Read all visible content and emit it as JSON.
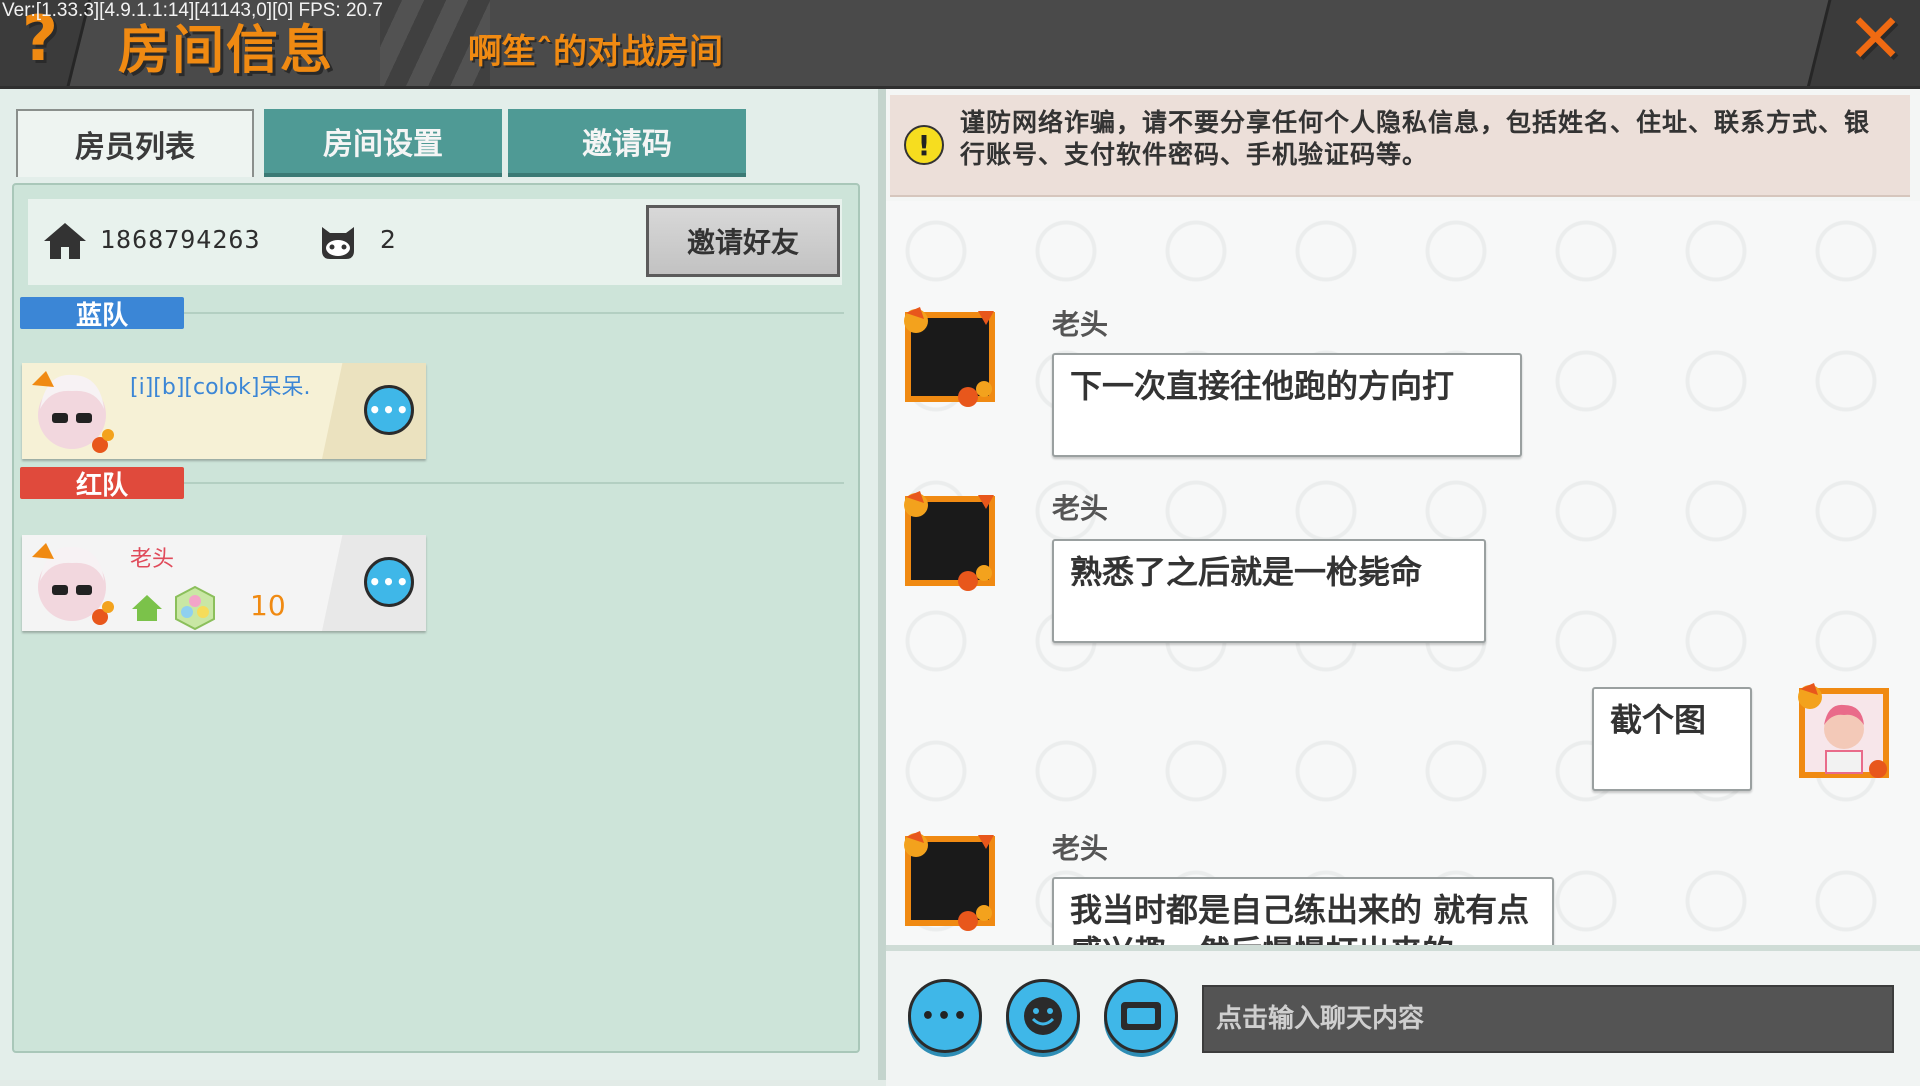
{
  "header": {
    "version": "Ver:[1.33.3][4.9.1.1:14][41143,0][0] FPS: 20.7",
    "help_glyph": "?",
    "title": "房间信息",
    "room_name": "啊笙ˆ的对战房间",
    "close_glyph": "✕"
  },
  "tabs": [
    {
      "label": "房员列表",
      "active": true
    },
    {
      "label": "房间设置",
      "active": false
    },
    {
      "label": "邀请码",
      "active": false
    }
  ],
  "room": {
    "id": "1868794263",
    "player_count": "2",
    "invite_button": "邀请好友"
  },
  "teams": {
    "blue": {
      "label": "蓝队",
      "color": "#3b86d6",
      "players": [
        {
          "name": "[i][b][colok]呆呆.",
          "name_color": "#3b86d6"
        }
      ]
    },
    "red": {
      "label": "红队",
      "color": "#e04a3c",
      "players": [
        {
          "name": "老头",
          "name_color": "#e04a5a",
          "level": "10"
        }
      ]
    }
  },
  "notice": {
    "icon": "!",
    "text": "谨防网络诈骗，请不要分享任何个人隐私信息，包括姓名、住址、联系方式、银行账号、支付软件密码、手机验证码等。"
  },
  "messages": [
    {
      "sender": "老头",
      "text": "下一次直接往他跑的方向打",
      "self": false
    },
    {
      "sender": "老头",
      "text": "熟悉了之后就是一枪毙命",
      "self": false
    },
    {
      "sender": "",
      "text": "截个图",
      "self": true
    },
    {
      "sender": "老头",
      "text": "我当时都是自己练出来的 就有点感兴趣，然后慢慢打出来的",
      "self": false
    }
  ],
  "input": {
    "placeholder": "点击输入聊天内容",
    "more_glyph": "•••",
    "emoji_icon": "smile-icon",
    "keyboard_icon": "keyboard-icon"
  },
  "colors": {
    "accent_orange": "#f08a12",
    "tab_teal": "#4f9a95",
    "button_blue": "#3fb7e8"
  }
}
